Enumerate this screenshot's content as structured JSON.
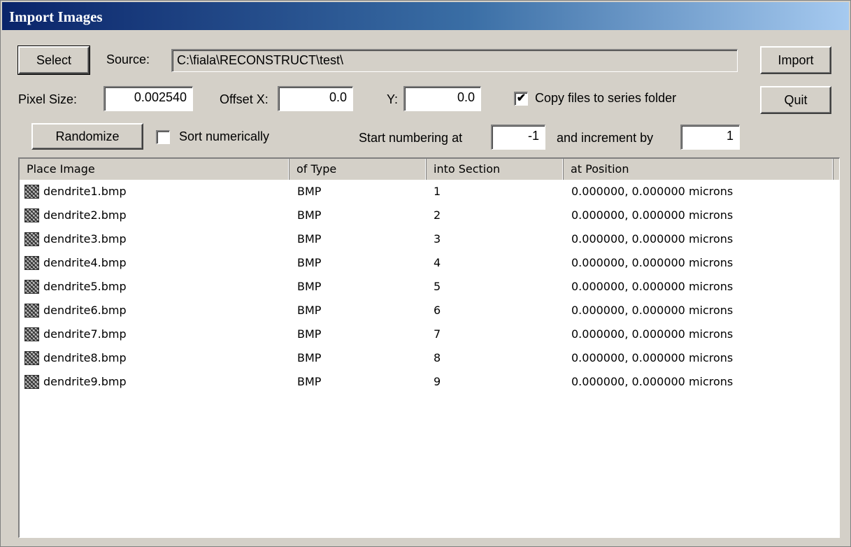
{
  "window": {
    "title": "Import Images"
  },
  "buttons": {
    "select": "Select",
    "import": "Import",
    "quit": "Quit",
    "randomize": "Randomize"
  },
  "source": {
    "label": "Source:",
    "value": "C:\\fiala\\RECONSTRUCT\\test\\"
  },
  "pixel_size": {
    "label": "Pixel Size:",
    "value": "0.002540"
  },
  "offset_x": {
    "label": "Offset X:",
    "value": "0.0"
  },
  "offset_y": {
    "label": "Y:",
    "value": "0.0"
  },
  "copy_files": {
    "label": "Copy files to series folder",
    "checked": true
  },
  "sort_numerically": {
    "label": "Sort numerically",
    "checked": false
  },
  "start_numbering": {
    "label": "Start numbering at",
    "value": "-1"
  },
  "increment": {
    "label": "and increment by",
    "value": "1"
  },
  "table": {
    "columns": [
      "Place Image",
      "of Type",
      "into Section",
      "at Position"
    ],
    "rows": [
      {
        "name": "dendrite1.bmp",
        "type": "BMP",
        "section": "1",
        "position": "0.000000, 0.000000 microns",
        "icon": "bitmap-file-icon"
      },
      {
        "name": "dendrite2.bmp",
        "type": "BMP",
        "section": "2",
        "position": "0.000000, 0.000000 microns",
        "icon": "bitmap-file-icon"
      },
      {
        "name": "dendrite3.bmp",
        "type": "BMP",
        "section": "3",
        "position": "0.000000, 0.000000 microns",
        "icon": "bitmap-file-icon"
      },
      {
        "name": "dendrite4.bmp",
        "type": "BMP",
        "section": "4",
        "position": "0.000000, 0.000000 microns",
        "icon": "bitmap-file-icon"
      },
      {
        "name": "dendrite5.bmp",
        "type": "BMP",
        "section": "5",
        "position": "0.000000, 0.000000 microns",
        "icon": "bitmap-file-icon"
      },
      {
        "name": "dendrite6.bmp",
        "type": "BMP",
        "section": "6",
        "position": "0.000000, 0.000000 microns",
        "icon": "bitmap-file-icon"
      },
      {
        "name": "dendrite7.bmp",
        "type": "BMP",
        "section": "7",
        "position": "0.000000, 0.000000 microns",
        "icon": "bitmap-file-icon"
      },
      {
        "name": "dendrite8.bmp",
        "type": "BMP",
        "section": "8",
        "position": "0.000000, 0.000000 microns",
        "icon": "bitmap-file-icon"
      },
      {
        "name": "dendrite9.bmp",
        "type": "BMP",
        "section": "9",
        "position": "0.000000, 0.000000 microns",
        "icon": "bitmap-file-icon"
      }
    ]
  },
  "colors": {
    "title_start": "#0a246a",
    "title_end": "#a6caf0",
    "face": "#d4d0c8"
  }
}
